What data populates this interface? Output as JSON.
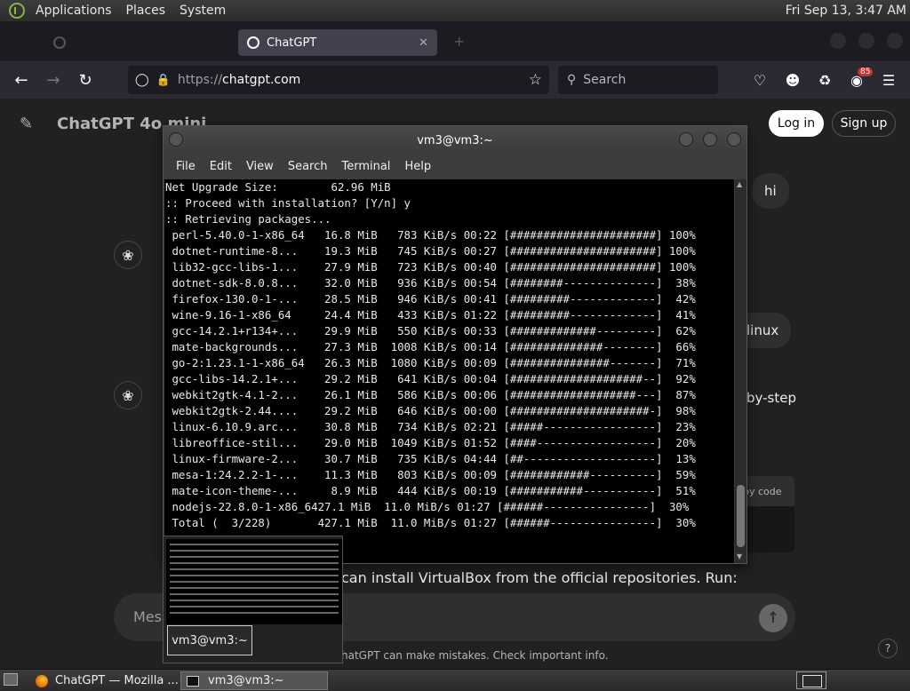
{
  "top_panel": {
    "menus": [
      "Applications",
      "Places",
      "System"
    ],
    "clock": "Fri Sep 13,  3:47 AM"
  },
  "browser": {
    "tabs": [
      {
        "label": "",
        "active": false
      },
      {
        "label": "ChatGPT",
        "active": true
      }
    ],
    "tab_close": "✕",
    "new_tab": "+",
    "url_scheme": "https://",
    "url_host": "chatgpt.com",
    "search_placeholder": "Search",
    "badge_count": "85"
  },
  "chatgpt": {
    "model": "ChatGPT 4o mini",
    "login": "Log in",
    "signup": "Sign up",
    "user_msg_1": "hi",
    "fragment_1": "linux",
    "fragment_2": "by-step",
    "code_header": "py code",
    "answer_fragment": "can install VirtualBox from the official repositories. Run:",
    "composer_placeholder": "Mess",
    "disclaimer": "hatGPT can make mistakes. Check important info.",
    "help": "?"
  },
  "terminal": {
    "title": "vm3@vm3:~",
    "menu": [
      "File",
      "Edit",
      "View",
      "Search",
      "Terminal",
      "Help"
    ],
    "lines": [
      "Net Upgrade Size:        62.96 MiB",
      "",
      ":: Proceed with installation? [Y/n] y",
      ":: Retrieving packages...",
      " perl-5.40.0-1-x86_64   16.8 MiB   783 KiB/s 00:22 [######################] 100%",
      " dotnet-runtime-8...    19.3 MiB   745 KiB/s 00:27 [######################] 100%",
      " lib32-gcc-libs-1...    27.9 MiB   723 KiB/s 00:40 [######################] 100%",
      " dotnet-sdk-8.0.8...    32.0 MiB   936 KiB/s 00:54 [########--------------]  38%",
      " firefox-130.0-1-...    28.5 MiB   946 KiB/s 00:41 [#########-------------]  42%",
      " wine-9.16-1-x86_64     24.4 MiB   433 KiB/s 01:22 [#########-------------]  41%",
      " gcc-14.2.1+r134+...    29.9 MiB   550 KiB/s 00:33 [#############---------]  62%",
      " mate-backgrounds...    27.3 MiB  1008 KiB/s 00:14 [##############--------]  66%",
      " go-2:1.23.1-1-x86_64   26.3 MiB  1080 KiB/s 00:09 [###############-------]  71%",
      " gcc-libs-14.2.1+...    29.2 MiB   641 KiB/s 00:04 [####################--]  92%",
      " webkit2gtk-4.1-2...    26.1 MiB   586 KiB/s 00:06 [###################---]  87%",
      " webkit2gtk-2.44....    29.2 MiB   646 KiB/s 00:00 [#####################-]  98%",
      " linux-6.10.9.arc...    30.8 MiB   734 KiB/s 02:21 [#####-----------------]  23%",
      " libreoffice-stil...    29.0 MiB  1049 KiB/s 01:52 [####------------------]  20%",
      " linux-firmware-2...    30.7 MiB   735 KiB/s 04:44 [##--------------------]  13%",
      " mesa-1:24.2.2-1-...    11.3 MiB   803 KiB/s 00:09 [############----------]  59%",
      " mate-icon-theme-...     8.9 MiB   444 KiB/s 00:19 [###########-----------]  51%",
      " nodejs-22.8.0-1-x86_6427.1 MiB  11.0 MiB/s 01:27 [######----------------]  30%",
      " Total (  3/228)       427.1 MiB  11.0 MiB/s 01:27 [######----------------]  30%"
    ]
  },
  "thumbnail": {
    "label": "vm3@vm3:~"
  },
  "taskbar": {
    "firefox_item": "ChatGPT — Mozilla ...",
    "terminal_item": "vm3@vm3:~"
  }
}
